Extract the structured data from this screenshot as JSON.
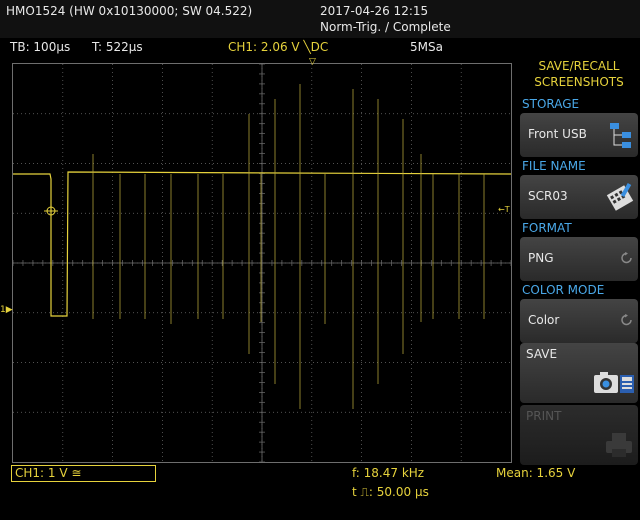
{
  "system": {
    "device": "HMO1524 (HW 0x10130000; SW 04.522)",
    "datetime": "2017-04-26 12:15",
    "state": "Norm-Trig. / Complete"
  },
  "status": {
    "timebase": "TB: 100µs",
    "trigger_time": "T: 522µs",
    "trigger": "CH1: 2.06 V ╲DC",
    "sample_rate": "5MSa"
  },
  "channel": {
    "label": "CH1: 1 V ≅"
  },
  "measurements": {
    "frequency": "f: 18.47 kHz",
    "period": "t ⎍: 50.00 µs",
    "mean": "Mean: 1.65 V"
  },
  "menu": {
    "title_line1": "SAVE/RECALL",
    "title_line2": "SCREENSHOTS",
    "storage_label": "STORAGE",
    "storage_value": "Front USB",
    "file_name_label": "FILE NAME",
    "file_name_value": "SCR03",
    "format_label": "FORMAT",
    "format_value": "PNG",
    "color_mode_label": "COLOR MODE",
    "color_mode_value": "Color",
    "save_label": "SAVE",
    "print_label": "PRINT"
  },
  "colors": {
    "trace": "#e6d23c",
    "menu_label": "#4aa8e8",
    "grid": "#6e6e6e"
  },
  "markers": {
    "channel_marker": "1",
    "trigger_level_marker": "←T"
  }
}
